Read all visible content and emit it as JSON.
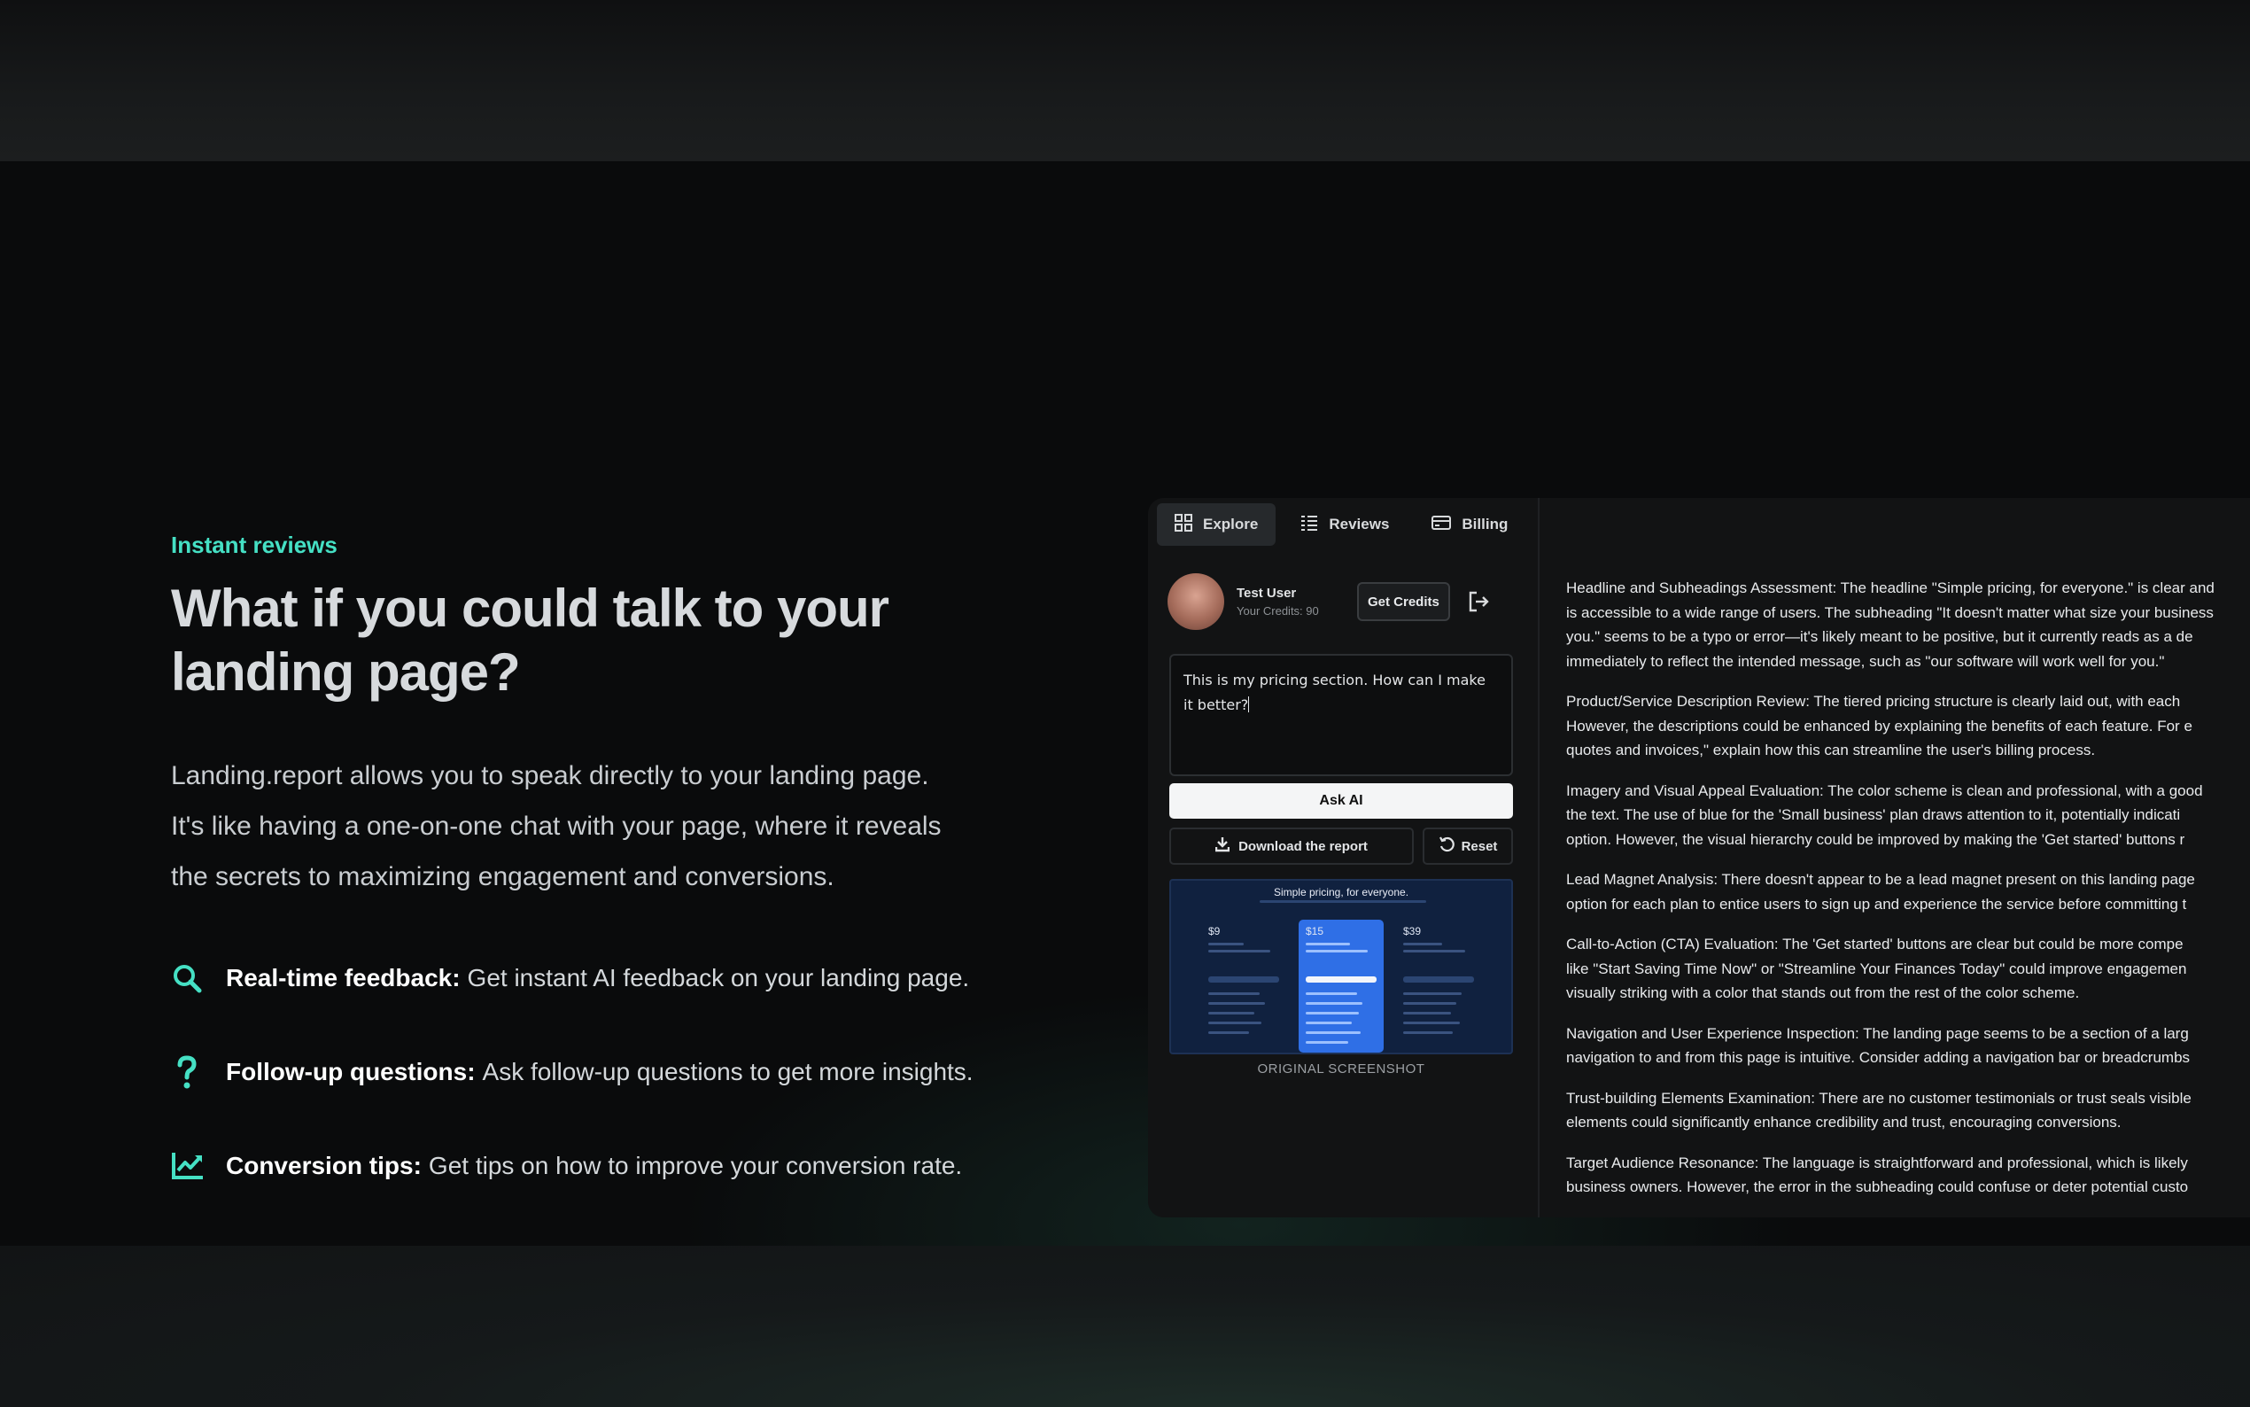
{
  "hero": {
    "eyebrow": "Instant reviews",
    "headline_line1": "What if you could talk to your",
    "headline_line2": "landing page?",
    "lead_line1": "Landing.report allows you to speak directly to your landing page.",
    "lead_line2": "It's like having a one-on-one chat with your page, where it reveals",
    "lead_line3": "the secrets to maximizing engagement and conversions.",
    "features": [
      {
        "title": "Real-time feedback:",
        "text": "Get instant AI feedback on your landing page.",
        "icon": "search-icon"
      },
      {
        "title": "Follow-up questions:",
        "text": "Ask follow-up questions to get more insights.",
        "icon": "question-icon"
      },
      {
        "title": "Conversion tips:",
        "text": "Get tips on how to improve your conversion rate.",
        "icon": "chart-trend-icon"
      }
    ],
    "accent_color": "#45e0c4"
  },
  "app": {
    "tabs": [
      {
        "label": "Explore",
        "icon": "grid-icon",
        "active": true
      },
      {
        "label": "Reviews",
        "icon": "list-icon",
        "active": false
      },
      {
        "label": "Billing",
        "icon": "card-icon",
        "active": false
      }
    ],
    "user": {
      "name": "Test User",
      "credits": "Your Credits: 90"
    },
    "get_credits_label": "Get Credits",
    "prompt_value": "This is my pricing section. How can I make it better?",
    "ask_label": "Ask AI",
    "download_label": "Download the report",
    "reset_label": "Reset",
    "thumbnail": {
      "title": "Simple pricing, for everyone.",
      "prices": [
        "$9",
        "$15",
        "$39"
      ],
      "caption": "ORIGINAL SCREENSHOT"
    },
    "report_lines": [
      [
        "Headline and Subheadings Assessment: The headline \"Simple pricing, for everyone.\" is clear and",
        "is accessible to a wide range of users. The subheading \"It doesn't matter what size your business",
        "you.\" seems to be a typo or error—it's likely meant to be positive, but it currently reads as a de",
        "immediately to reflect the intended message, such as \"our software will work well for you.\""
      ],
      [
        "Product/Service Description Review: The tiered pricing structure is clearly laid out, with each",
        "However, the descriptions could be enhanced by explaining the benefits of each feature. For e",
        "quotes and invoices,\" explain how this can streamline the user's billing process."
      ],
      [
        "Imagery and Visual Appeal Evaluation: The color scheme is clean and professional, with a good",
        "the text. The use of blue for the 'Small business' plan draws attention to it, potentially indicati",
        "option. However, the visual hierarchy could be improved by making the 'Get started' buttons r"
      ],
      [
        "Lead Magnet Analysis: There doesn't appear to be a lead magnet present on this landing page",
        "option for each plan to entice users to sign up and experience the service before committing t"
      ],
      [
        "Call-to-Action (CTA) Evaluation: The 'Get started' buttons are clear but could be more compe",
        "like \"Start Saving Time Now\" or \"Streamline Your Finances Today\" could improve engagemen",
        "visually striking with a color that stands out from the rest of the color scheme."
      ],
      [
        "Navigation and User Experience Inspection: The landing page seems to be a section of a larg",
        "navigation to and from this page is intuitive. Consider adding a navigation bar or breadcrumbs"
      ],
      [
        "Trust-building Elements Examination: There are no customer testimonials or trust seals visible",
        "elements could significantly enhance credibility and trust, encouraging conversions."
      ],
      [
        "Target Audience Resonance: The language is straightforward and professional, which is likely",
        "business owners. However, the error in the subheading could confuse or deter potential custo"
      ]
    ]
  }
}
